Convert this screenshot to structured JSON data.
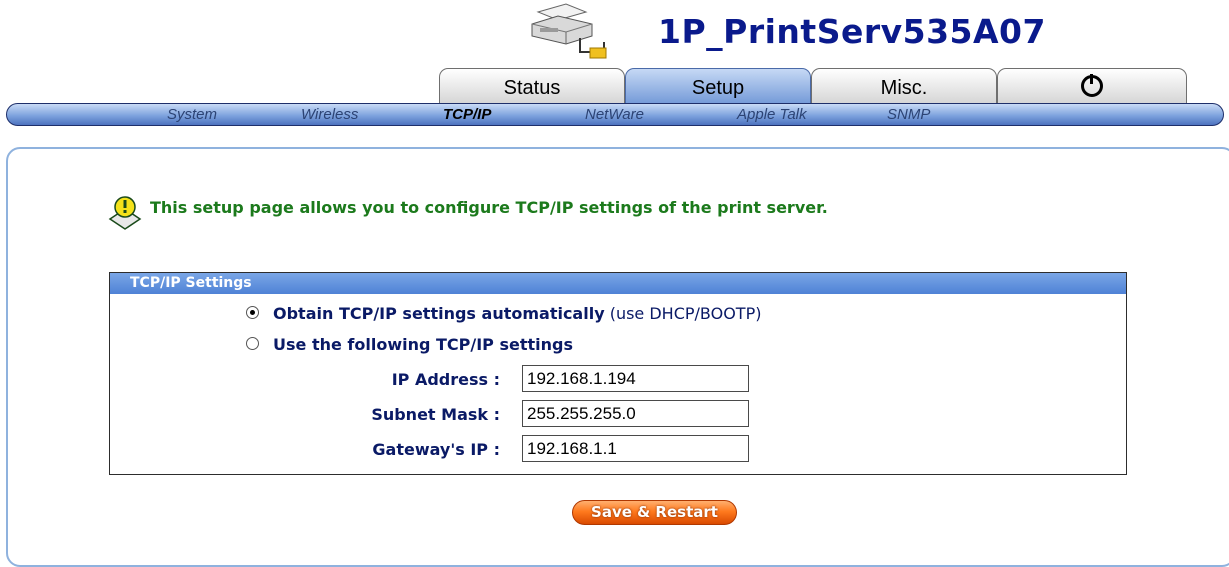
{
  "header": {
    "device_name": "1P_PrintServ535A07"
  },
  "tabs": [
    {
      "label": "Status",
      "active": false
    },
    {
      "label": "Setup",
      "active": true
    },
    {
      "label": "Misc.",
      "active": false
    },
    {
      "label": "",
      "icon": "power-icon",
      "active": false
    }
  ],
  "subnav": [
    {
      "label": "System",
      "active": false
    },
    {
      "label": "Wireless",
      "active": false
    },
    {
      "label": "TCP/IP",
      "active": true
    },
    {
      "label": "NetWare",
      "active": false
    },
    {
      "label": "Apple Talk",
      "active": false
    },
    {
      "label": "SNMP",
      "active": false
    }
  ],
  "info": {
    "icon": "lightbulb-hint-icon",
    "text": "This setup page allows you to configure TCP/IP settings of the print server."
  },
  "settings": {
    "title": "TCP/IP Settings",
    "auto_option": {
      "label_bold": "Obtain TCP/IP settings automatically",
      "label_suffix": " (use DHCP/BOOTP)",
      "selected": true
    },
    "manual_option": {
      "label_bold": "Use the following TCP/IP settings",
      "selected": false
    },
    "fields": [
      {
        "label": "IP Address :",
        "value": "192.168.1.194"
      },
      {
        "label": "Subnet Mask :",
        "value": "255.255.255.0"
      },
      {
        "label": "Gateway's IP :",
        "value": "192.168.1.1"
      }
    ]
  },
  "buttons": {
    "save_restart": "Save & Restart"
  },
  "colors": {
    "title": "#0a1a8c",
    "hint_text": "#1c7a1c",
    "label_text": "#0a1a66",
    "header_bar": "#4f82d6",
    "button": "#ff7a1e"
  }
}
